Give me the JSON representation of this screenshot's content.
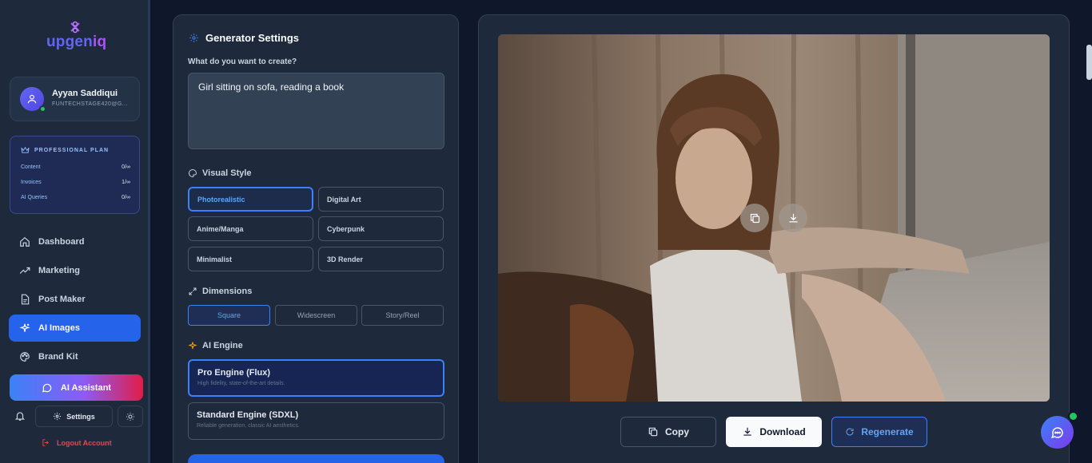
{
  "brand": {
    "name_part1": "upgen",
    "name_part2": "iq"
  },
  "user": {
    "name": "Ayyan Saddiqui",
    "email": "FUNTECHSTAGE420@G..."
  },
  "plan": {
    "title": "PROFESSIONAL PLAN",
    "rows": [
      {
        "label": "Content",
        "value": "0/∞"
      },
      {
        "label": "Invoices",
        "value": "1/∞"
      },
      {
        "label": "AI Queries",
        "value": "0/∞"
      }
    ]
  },
  "nav": [
    {
      "label": "Dashboard",
      "icon": "home-icon"
    },
    {
      "label": "Marketing",
      "icon": "trending-icon"
    },
    {
      "label": "Post Maker",
      "icon": "document-icon"
    },
    {
      "label": "AI Images",
      "icon": "sparkles-icon",
      "active": true
    },
    {
      "label": "Brand Kit",
      "icon": "palette-icon"
    }
  ],
  "assistant_label": "AI Assistant",
  "settings_label": "Settings",
  "logout_label": "Logout Account",
  "generator": {
    "title": "Generator Settings",
    "prompt_label": "What do you want to create?",
    "prompt_value": "Girl sitting on sofa, reading a book",
    "visual_style_label": "Visual Style",
    "styles": [
      "Photorealistic",
      "Digital Art",
      "Anime/Manga",
      "Cyberpunk",
      "Minimalist",
      "3D Render"
    ],
    "selected_style": "Photorealistic",
    "dimensions_label": "Dimensions",
    "dimensions": [
      "Square",
      "Widescreen",
      "Story/Reel"
    ],
    "selected_dimension": "Square",
    "engine_label": "AI Engine",
    "engines": [
      {
        "title": "Pro Engine (Flux)",
        "desc": "High fidelity, state-of-the-art details."
      },
      {
        "title": "Standard Engine (SDXL)",
        "desc": "Reliable generation, classic AI aesthetics."
      }
    ],
    "selected_engine": "Pro Engine (Flux)"
  },
  "preview": {
    "copy_label": "Copy",
    "download_label": "Download",
    "regenerate_label": "Regenerate"
  },
  "colors": {
    "accent": "#2563eb",
    "bg": "#0f172a",
    "panel": "#1e293b",
    "online": "#22c55e",
    "danger": "#ef4444"
  }
}
